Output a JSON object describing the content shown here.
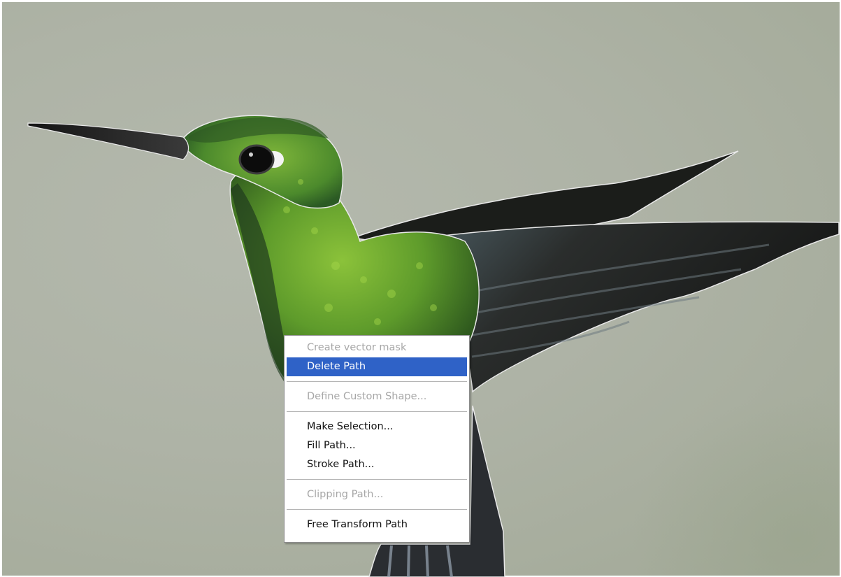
{
  "context_menu": {
    "items": [
      {
        "label": "Create vector mask",
        "disabled": true
      },
      {
        "label": "Delete Path",
        "selected": true
      },
      {
        "label": "Define Custom Shape...",
        "disabled": true
      },
      {
        "label": "Make Selection..."
      },
      {
        "label": "Fill Path..."
      },
      {
        "label": "Stroke Path..."
      },
      {
        "label": "Clipping Path...",
        "disabled": true
      },
      {
        "label": "Free Transform Path"
      }
    ]
  },
  "colors": {
    "background": "#aeb3a6",
    "bird_green": "#5c9a2a",
    "wing_dark": "#1d1f1c",
    "highlight": "#2f62c7",
    "disabled_text": "#a7a7a7"
  }
}
